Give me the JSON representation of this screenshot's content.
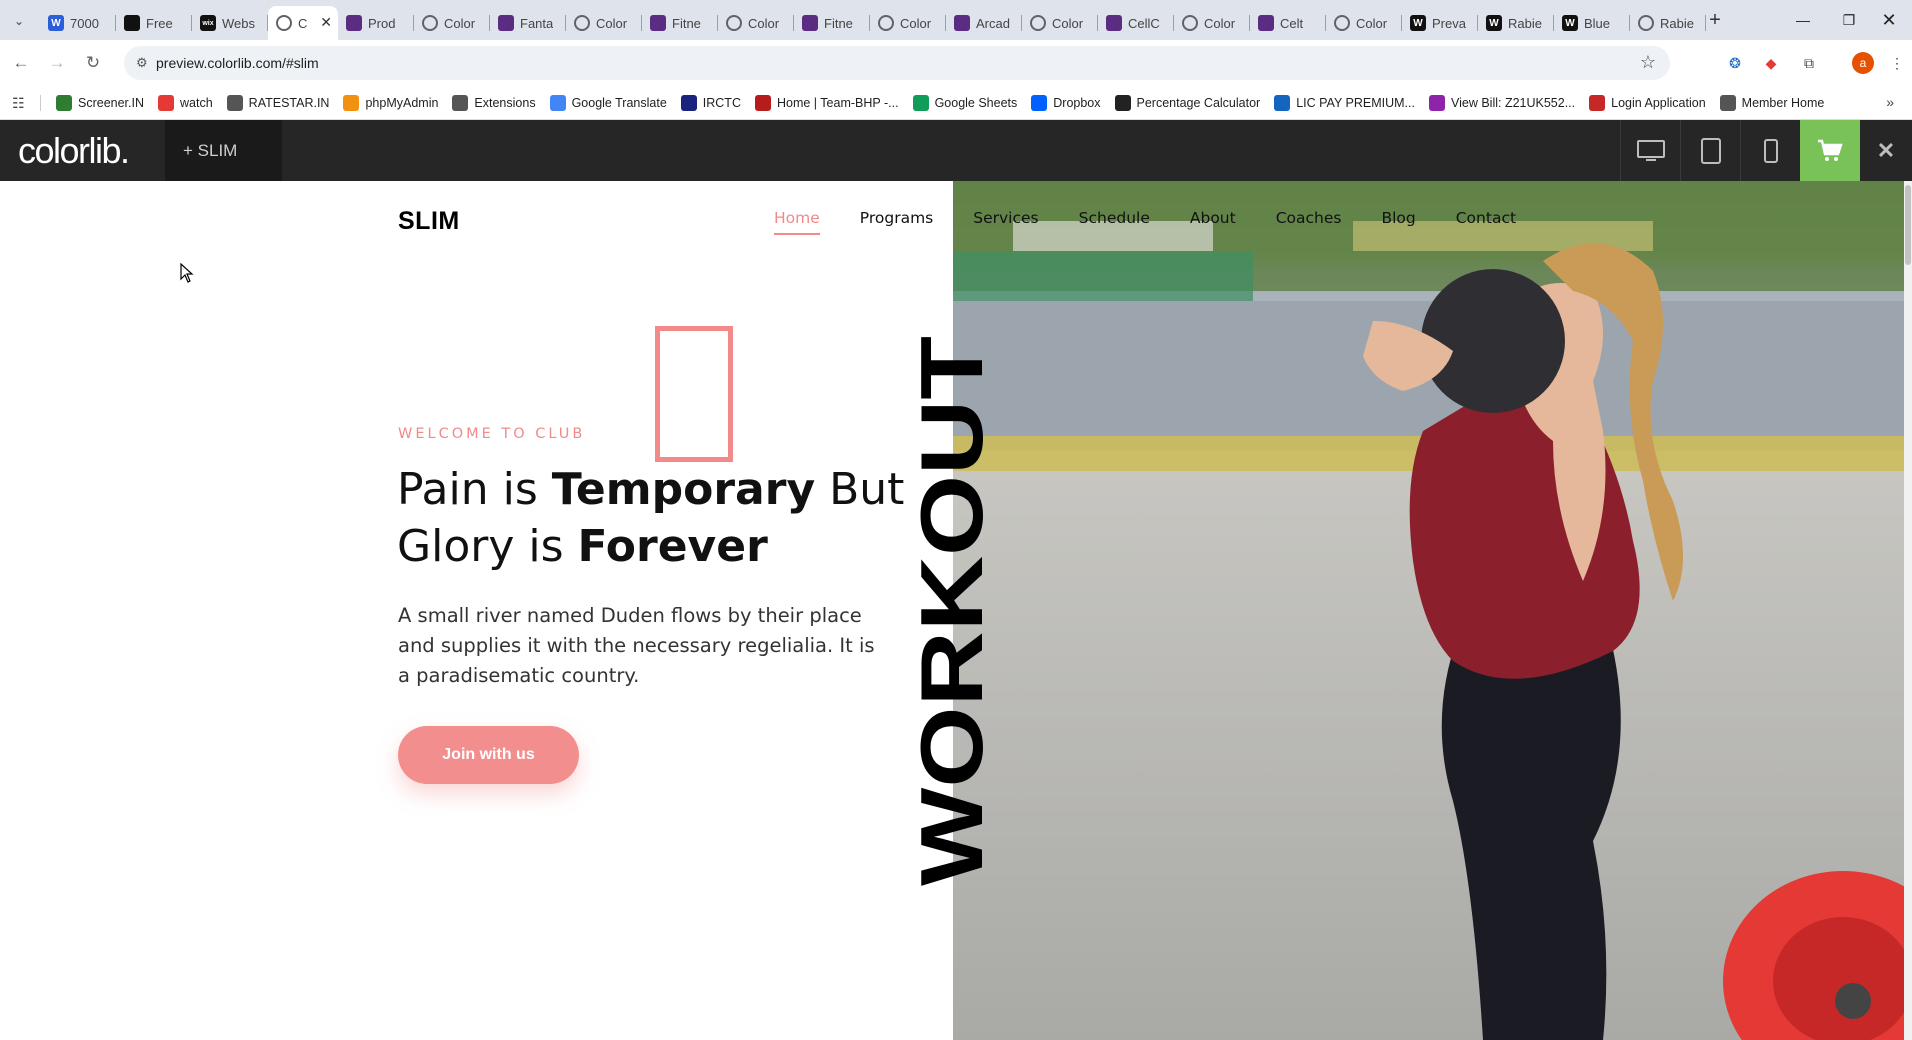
{
  "browser": {
    "tabs": [
      {
        "title": "7000",
        "icon": "word-icon",
        "color": "#2b5fd9"
      },
      {
        "title": "Free",
        "icon": "framer-icon",
        "color": "#111111"
      },
      {
        "title": "Webs",
        "icon": "wix-icon",
        "color": "#111111"
      },
      {
        "title": "C",
        "icon": "globe-icon",
        "color": "#5f6368",
        "active": true
      },
      {
        "title": "Prod",
        "icon": "colorlib-icon",
        "color": "#5a2d82"
      },
      {
        "title": "Color",
        "icon": "globe-icon",
        "color": "#5f6368"
      },
      {
        "title": "Fanta",
        "icon": "colorlib-icon",
        "color": "#5a2d82"
      },
      {
        "title": "Color",
        "icon": "globe-icon",
        "color": "#5f6368"
      },
      {
        "title": "Fitne",
        "icon": "colorlib-icon",
        "color": "#5a2d82"
      },
      {
        "title": "Color",
        "icon": "globe-icon",
        "color": "#5f6368"
      },
      {
        "title": "Fitne",
        "icon": "colorlib-icon",
        "color": "#5a2d82"
      },
      {
        "title": "Color",
        "icon": "globe-icon",
        "color": "#5f6368"
      },
      {
        "title": "Arcad",
        "icon": "colorlib-icon",
        "color": "#5a2d82"
      },
      {
        "title": "Color",
        "icon": "globe-icon",
        "color": "#5f6368"
      },
      {
        "title": "CellC",
        "icon": "colorlib-icon",
        "color": "#5a2d82"
      },
      {
        "title": "Color",
        "icon": "globe-icon",
        "color": "#5f6368"
      },
      {
        "title": "Celt",
        "icon": "colorlib-icon",
        "color": "#5a2d82"
      },
      {
        "title": "Color",
        "icon": "globe-icon",
        "color": "#5f6368"
      },
      {
        "title": "Preva",
        "icon": "wikipedia-icon",
        "color": "#111111"
      },
      {
        "title": "Rabie",
        "icon": "wikipedia-icon",
        "color": "#111111"
      },
      {
        "title": "Blue",
        "icon": "wikipedia-icon",
        "color": "#111111"
      },
      {
        "title": "Rabie",
        "icon": "globe-icon",
        "color": "#5f6368"
      }
    ],
    "url": "preview.colorlib.com/#slim",
    "bookmarks": [
      {
        "label": "Screener.IN",
        "icon": "chart-icon",
        "color": "#2e7d32"
      },
      {
        "label": "watch",
        "icon": "youtube-icon",
        "color": "#e53935"
      },
      {
        "label": "RATESTAR.IN",
        "icon": "star-icon",
        "color": "#555555"
      },
      {
        "label": "phpMyAdmin",
        "icon": "phpmyadmin-icon",
        "color": "#f29111"
      },
      {
        "label": "Extensions",
        "icon": "puzzle-icon",
        "color": "#555555"
      },
      {
        "label": "Google Translate",
        "icon": "translate-icon",
        "color": "#4285f4"
      },
      {
        "label": "IRCTC",
        "icon": "irctc-icon",
        "color": "#1a237e"
      },
      {
        "label": "Home | Team-BHP -...",
        "icon": "teambhp-icon",
        "color": "#b71c1c"
      },
      {
        "label": "Google Sheets",
        "icon": "sheets-icon",
        "color": "#0f9d58"
      },
      {
        "label": "Dropbox",
        "icon": "dropbox-icon",
        "color": "#0061ff"
      },
      {
        "label": "Percentage Calculator",
        "icon": "percent-icon",
        "color": "#222222"
      },
      {
        "label": "LIC PAY PREMIUM...",
        "icon": "lic-icon",
        "color": "#1565c0"
      },
      {
        "label": "View Bill: Z21UK552...",
        "icon": "bill-icon",
        "color": "#8e24aa"
      },
      {
        "label": "Login Application",
        "icon": "login-icon",
        "color": "#c62828"
      },
      {
        "label": "Member Home",
        "icon": "globe-icon",
        "color": "#555555"
      }
    ]
  },
  "colorlib_bar": {
    "logo": "colorlib.",
    "theme_label": "+ SLIM",
    "accent": "#78c257"
  },
  "site": {
    "brand": "SLIM",
    "nav": [
      "Home",
      "Programs",
      "Services",
      "Schedule",
      "About",
      "Coaches",
      "Blog",
      "Contact"
    ],
    "active_nav": "Home",
    "welcome": "WELCOME TO CLUB",
    "headline": {
      "p1": "Pain is ",
      "b1": "Temporary",
      "p2": " But Glory is ",
      "b2": "Forever"
    },
    "lead": "A small river named Duden flows by their place and supplies it with the necessary regelialia. It is a paradisematic country.",
    "cta": "Join with us",
    "vertical_word": "WORKOUT",
    "accent": "#f28a8a"
  }
}
